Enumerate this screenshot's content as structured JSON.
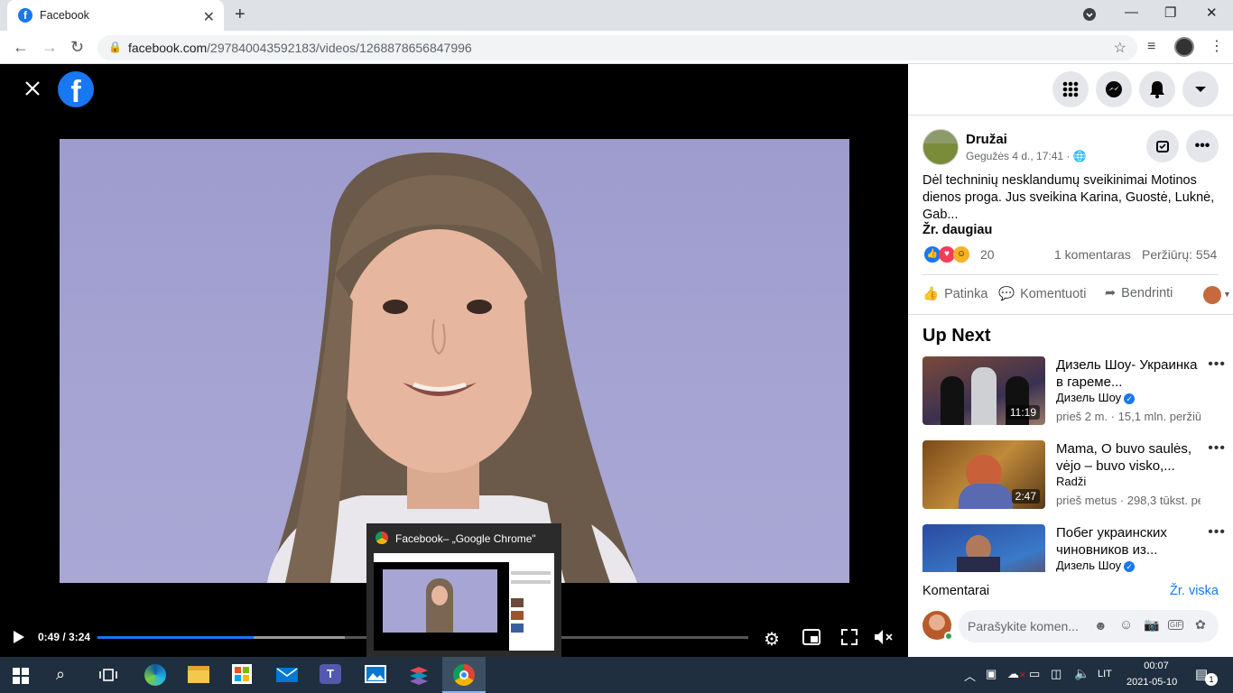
{
  "browser": {
    "tab_title": "Facebook",
    "url_domain": "facebook.com",
    "url_path": "/297840043592183/videos/1268878656847996"
  },
  "player": {
    "time": "0:49 / 3:24",
    "progress": 0.24,
    "buffered": 0.38
  },
  "preview": {
    "title": "Facebook– „Google Chrome\""
  },
  "post": {
    "author": "Družai",
    "date": "Gegužės 4 d., 17:41 ·",
    "text": "Dėl techninių nesklandumų sveikinimai Motinos dienos proga. Jus sveikina Karina, Guostė, Luknė, Gab...",
    "see_more": "Žr. daugiau",
    "reactions_count": "20",
    "comments": "1 komentaras",
    "views": "Peržiūrų: 554",
    "like": "Patinka",
    "comment": "Komentuoti",
    "share": "Bendrinti"
  },
  "upnext": {
    "heading": "Up Next",
    "items": [
      {
        "title": "Дизель Шоу- Украинка в гареме...",
        "channel": "Дизель Шоу",
        "meta": "prieš 2 m. · 15,1 mln. peržiūr",
        "duration": "11:19"
      },
      {
        "title": "Mama, O buvo saulės, vėjo – buvo visko,...",
        "channel": "Radži",
        "meta": "prieš metus · 298,3 tūkst. pe",
        "duration": "2:47"
      },
      {
        "title": "Побег украинских чиновников из...",
        "channel": "Дизель Шоу",
        "meta": "",
        "duration": ""
      }
    ]
  },
  "comments_section": {
    "label": "Komentarai",
    "see_all": "Žr. viska",
    "placeholder": "Parašykite komen..."
  },
  "taskbar": {
    "lang": "LIT",
    "time": "00:07",
    "date": "2021-05-10",
    "notifications": "1"
  },
  "icons": [
    "close-icon",
    "facebook-logo",
    "apps-icon",
    "messenger-icon",
    "bell-icon",
    "caret-icon",
    "play-icon",
    "settings-icon",
    "pip-icon",
    "fullscreen-icon",
    "mute-icon"
  ]
}
